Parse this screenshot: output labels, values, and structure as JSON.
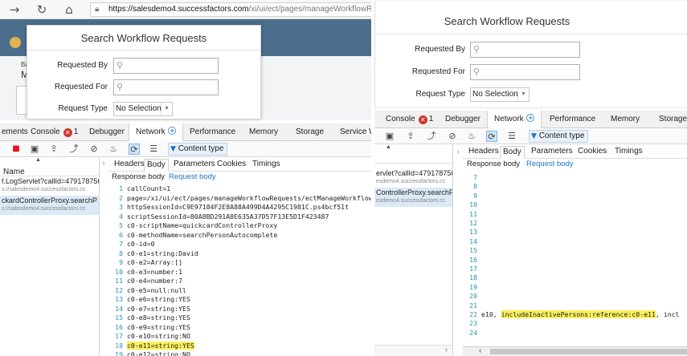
{
  "left": {
    "browser": {
      "url_domain": "https://salesdemo4.successfactors.com",
      "url_path": "/xi/ui/ect/pages/manageWorkflowReque"
    },
    "app_bg": {
      "text1": "Ba",
      "text2": "M"
    },
    "dialog": {
      "title": "Search Workflow Requests",
      "fields": [
        {
          "label": "Requested By",
          "value": ""
        },
        {
          "label": "Requested For",
          "value": ""
        }
      ],
      "request_type": {
        "label": "Request Type",
        "value": "No Selection"
      }
    },
    "devtools": {
      "tabs": {
        "elements": "ements",
        "console": "Console",
        "console_errors": "1",
        "debugger": "Debugger",
        "network": "Network",
        "performance": "Performance",
        "memory": "Memory",
        "storage": "Storage",
        "service_workers": "Service W"
      },
      "toolbar": {
        "content_type": "Content type"
      },
      "request_list": {
        "header": "Name",
        "items": [
          {
            "name": "f.LogServlet?callId=479178756",
            "host": "s://salesdemo4.successfactors.cc",
            "selected": false
          },
          {
            "name": "ckardControllerProxy.searchP",
            "host": "s://salesdemo4.successfactors.cc",
            "selected": true
          }
        ]
      },
      "detail_tabs": [
        "Headers",
        "Body",
        "Parameters",
        "Cookies",
        "Timings"
      ],
      "active_detail_tab": "Body",
      "sub_tabs": {
        "response": "Response body",
        "request": "Request body"
      },
      "code_lines": [
        {
          "n": "1",
          "t": "callCount=1",
          "hl": false
        },
        {
          "n": "2",
          "t": "page=/xi/ui/ect/pages/manageWorkflowRequests/ectManageWorkflowRe",
          "hl": false
        },
        {
          "n": "3",
          "t": "httpSessionId=C9E97184F2E8A88A499D4A4295C1981C.ps4bcf51t",
          "hl": false
        },
        {
          "n": "4",
          "t": "scriptSessionId=80A8BD291A8E635A37D57F13E5D1F423487",
          "hl": false
        },
        {
          "n": "5",
          "t": "c0-scriptName=quickcardControllerProxy",
          "hl": false
        },
        {
          "n": "6",
          "t": "c0-methodName=searchPersonAutocomplete",
          "hl": false
        },
        {
          "n": "7",
          "t": "c0-id=0",
          "hl": false
        },
        {
          "n": "8",
          "t": "c0-e1=string:David",
          "hl": false
        },
        {
          "n": "9",
          "t": "c0-e2=Array:[]",
          "hl": false
        },
        {
          "n": "10",
          "t": "c0-e3=number:1",
          "hl": false
        },
        {
          "n": "11",
          "t": "c0-e4=number:7",
          "hl": false
        },
        {
          "n": "12",
          "t": "c0-e5=null:null",
          "hl": false
        },
        {
          "n": "13",
          "t": "c0-e6=string:YES",
          "hl": false
        },
        {
          "n": "14",
          "t": "c0-e7=string:YES",
          "hl": false
        },
        {
          "n": "15",
          "t": "c0-e8=string:YES",
          "hl": false
        },
        {
          "n": "16",
          "t": "c0-e9=string:YES",
          "hl": false
        },
        {
          "n": "17",
          "t": "c0-e10=string:NO",
          "hl": false
        },
        {
          "n": "18",
          "t": "c0-e11=string:YES",
          "hl": true
        },
        {
          "n": "19",
          "t": "c0-e12=string:NO",
          "hl": false
        }
      ]
    }
  },
  "right": {
    "app_bg": {
      "text1": "Ba",
      "text2": "V"
    },
    "dialog": {
      "title": "Search Workflow Requests",
      "fields": [
        {
          "label": "Requested By",
          "value": ""
        },
        {
          "label": "Requested For",
          "value": ""
        }
      ],
      "request_type": {
        "label": "Request Type",
        "value": "No Selection"
      }
    },
    "devtools": {
      "tabs": {
        "console": "Console",
        "console_errors": "1",
        "debugger": "Debugger",
        "network": "Network",
        "performance": "Performance",
        "memory": "Memory",
        "storage": "Storage"
      },
      "toolbar": {
        "content_type": "Content type"
      },
      "request_list": {
        "items": [
          {
            "name": "ervlet?callId=479178756",
            "host": "esdemo4.successfactors.cc",
            "selected": false
          },
          {
            "name": "ControllerProxy.searchP",
            "host": "esdemo4.successfactors.cc",
            "selected": true
          }
        ]
      },
      "detail_tabs": [
        "Headers",
        "Body",
        "Parameters",
        "Cookies",
        "Timings"
      ],
      "active_detail_tab": "Body",
      "sub_tabs": {
        "response": "Response body",
        "request": "Request body"
      },
      "code_lines": [
        {
          "n": "7",
          "pre": "",
          "hl_text": "",
          "post": ""
        },
        {
          "n": "8",
          "pre": "",
          "hl_text": "",
          "post": ""
        },
        {
          "n": "9",
          "pre": "",
          "hl_text": "",
          "post": ""
        },
        {
          "n": "10",
          "pre": "",
          "hl_text": "",
          "post": ""
        },
        {
          "n": "11",
          "pre": "",
          "hl_text": "",
          "post": ""
        },
        {
          "n": "12",
          "pre": "",
          "hl_text": "",
          "post": ""
        },
        {
          "n": "13",
          "pre": "",
          "hl_text": "",
          "post": ""
        },
        {
          "n": "14",
          "pre": "",
          "hl_text": "",
          "post": ""
        },
        {
          "n": "15",
          "pre": "",
          "hl_text": "",
          "post": ""
        },
        {
          "n": "16",
          "pre": "",
          "hl_text": "",
          "post": ""
        },
        {
          "n": "17",
          "pre": "",
          "hl_text": "",
          "post": ""
        },
        {
          "n": "18",
          "pre": "",
          "hl_text": "",
          "post": ""
        },
        {
          "n": "19",
          "pre": "",
          "hl_text": "",
          "post": ""
        },
        {
          "n": "20",
          "pre": "",
          "hl_text": "",
          "post": ""
        },
        {
          "n": "21",
          "pre": "",
          "hl_text": "",
          "post": ""
        },
        {
          "n": "22",
          "pre": "e10, ",
          "hl_text": "includeInactivePersons:reference:c0-e11",
          "post": ", incl"
        },
        {
          "n": "23",
          "pre": "",
          "hl_text": "",
          "post": ""
        },
        {
          "n": "24",
          "pre": "",
          "hl_text": "",
          "post": ""
        }
      ]
    }
  },
  "colors": {
    "app_band": "#4b6e8c",
    "highlight": "#fbf05a",
    "link_blue": "#1a73c8",
    "error_red": "#d0342c"
  }
}
